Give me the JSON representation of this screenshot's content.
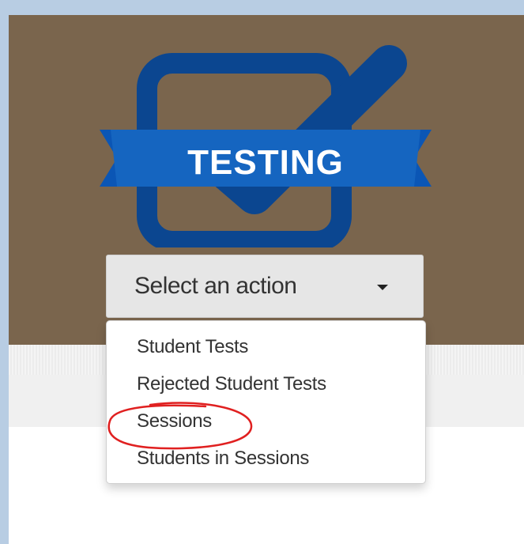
{
  "logo": {
    "text": "TESTING",
    "colors": {
      "brand_dark": "#0b4690",
      "ribbon": "#1565c0"
    }
  },
  "dropdown": {
    "label": "Select an action",
    "items": [
      {
        "label": "Student Tests"
      },
      {
        "label": "Rejected Student Tests"
      },
      {
        "label": "Sessions"
      },
      {
        "label": "Students in Sessions"
      }
    ]
  },
  "annotation": {
    "color": "#e02020",
    "target": "Sessions"
  },
  "colors": {
    "hero_background": "#7a654d",
    "page_border": "#b8cde3"
  }
}
